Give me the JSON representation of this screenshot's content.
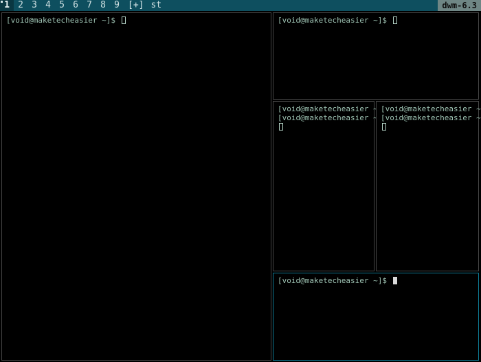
{
  "bar": {
    "tags": [
      "1",
      "2",
      "3",
      "4",
      "5",
      "6",
      "7",
      "8",
      "9"
    ],
    "active_tag": 0,
    "layout_symbol": "[+]",
    "title": "st",
    "status": "dwm-6.3"
  },
  "prompt_text": "[void@maketecheasier ~]$",
  "windows": {
    "master": {
      "prompt": "[void@maketecheasier ~]$"
    },
    "stack_top": {
      "prompt": "[void@maketecheasier ~]$"
    },
    "stack_mid_left": {
      "line1": "[void@maketecheasier ~]$",
      "line2": "[void@maketecheasier ~]$"
    },
    "stack_mid_right": {
      "line1": "[void@maketecheasier ~]$",
      "line2": "[void@maketecheasier ~]$"
    },
    "stack_bottom": {
      "prompt": "[void@maketecheasier ~]$"
    }
  }
}
